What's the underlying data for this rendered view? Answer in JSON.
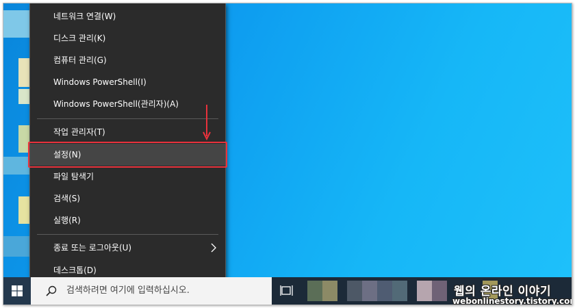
{
  "menu": {
    "items": [
      {
        "label": "네트워크 연결(W)",
        "name": "menu-item-network-connections"
      },
      {
        "label": "디스크 관리(K)",
        "name": "menu-item-disk-management"
      },
      {
        "label": "컴퓨터 관리(G)",
        "name": "menu-item-computer-management"
      },
      {
        "label": "Windows PowerShell(I)",
        "name": "menu-item-powershell"
      },
      {
        "label": "Windows PowerShell(관리자)(A)",
        "name": "menu-item-powershell-admin"
      },
      {
        "label": "작업 관리자(T)",
        "name": "menu-item-task-manager"
      },
      {
        "label": "설정(N)",
        "name": "menu-item-settings",
        "highlighted": true
      },
      {
        "label": "파일 탐색기",
        "name": "menu-item-file-explorer"
      },
      {
        "label": "검색(S)",
        "name": "menu-item-search"
      },
      {
        "label": "실행(R)",
        "name": "menu-item-run"
      },
      {
        "label": "종료 또는 로그아웃(U)",
        "name": "menu-item-shutdown-signout",
        "submenu": true
      },
      {
        "label": "데스크톱(D)",
        "name": "menu-item-desktop"
      }
    ]
  },
  "taskbar": {
    "search_placeholder": "검색하려면 여기에 입력하십시오."
  },
  "watermark": {
    "title": "웹의 온라인 이야기",
    "url": "webonlinestory.tistory.com"
  },
  "colors": {
    "menu_bg": "#2b2b2b",
    "highlight_border": "#e9323c",
    "desktop": "#0e9df0"
  }
}
